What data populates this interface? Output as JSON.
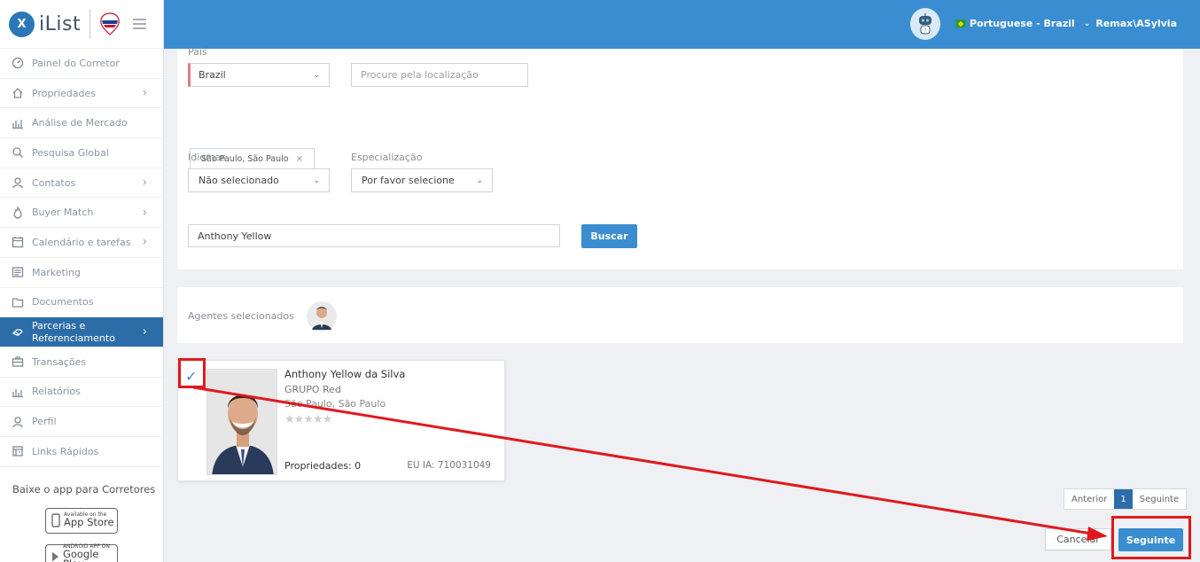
{
  "brand": {
    "logo_letter": "X",
    "name": "iList"
  },
  "sidebar": {
    "items": [
      {
        "label": "Painel do Corretor",
        "icon": "dashboard-icon",
        "chevron": false
      },
      {
        "label": "Propriedades",
        "icon": "home-icon",
        "chevron": true
      },
      {
        "label": "Análise de Mercado",
        "icon": "bar-chart-icon",
        "chevron": false
      },
      {
        "label": "Pesquisa Global",
        "icon": "search-icon",
        "chevron": false
      },
      {
        "label": "Contatos",
        "icon": "contacts-icon",
        "chevron": true
      },
      {
        "label": "Buyer Match",
        "icon": "flame-icon",
        "chevron": true
      },
      {
        "label": "Calendário e tarefas",
        "icon": "calendar-icon",
        "chevron": true
      },
      {
        "label": "Marketing",
        "icon": "newspaper-icon",
        "chevron": false
      },
      {
        "label": "Documentos",
        "icon": "folder-icon",
        "chevron": false
      },
      {
        "label": "Parcerias e Referenciamento",
        "icon": "handshake-icon",
        "chevron": true,
        "active": true
      },
      {
        "label": "Transações",
        "icon": "briefcase-icon",
        "chevron": false
      },
      {
        "label": "Relatórios",
        "icon": "report-icon",
        "chevron": false
      },
      {
        "label": "Perfil",
        "icon": "user-icon",
        "chevron": false
      },
      {
        "label": "Links Rápidos",
        "icon": "links-icon",
        "chevron": false
      }
    ],
    "app_title": "Baixe o app para Corretores",
    "app_store": {
      "small": "Available on the",
      "big": "App Store"
    },
    "google_play": {
      "small": "ANDROID APP ON",
      "big": "Google Play"
    }
  },
  "topbar": {
    "language": "Portuguese - Brazil",
    "user": "Remax\\ASylvia"
  },
  "filters": {
    "country_label": "País",
    "country_value": "Brazil",
    "location_placeholder": "Procure pela localização",
    "location_chip": "São Paulo, São Paulo",
    "languages_label": "Idiomas",
    "languages_value": "Não selecionado",
    "specialization_label": "Especialização",
    "specialization_value": "Por favor selecione",
    "name_value": "Anthony Yellow",
    "search_button": "Buscar"
  },
  "selected": {
    "label": "Agentes selecionados"
  },
  "agent": {
    "name": "Anthony Yellow da Silva",
    "agency": "GRUPO Red",
    "location": "São Paulo, São Paulo",
    "stars": "★★★★★",
    "rating": 0,
    "properties": "Propriedades: 0",
    "id": "EU IA: 710031049"
  },
  "pager": {
    "prev": "Anterior",
    "page": "1",
    "next": "Seguinte"
  },
  "actions": {
    "cancel": "Cancelar",
    "next": "Seguinte"
  },
  "colors": {
    "primary": "#3a8dd0",
    "sidebar_active": "#2c6da8",
    "annotation": "#e0191c"
  }
}
